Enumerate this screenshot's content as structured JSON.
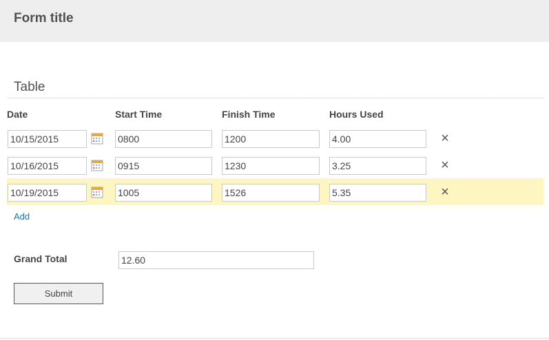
{
  "form": {
    "title": "Form title"
  },
  "section": {
    "title": "Table"
  },
  "table": {
    "columns": [
      "Date",
      "Start Time",
      "Finish Time",
      "Hours Used"
    ],
    "rows": [
      {
        "date": "10/15/2015",
        "start": "0800",
        "finish": "1200",
        "hours": "4.00",
        "highlighted": false
      },
      {
        "date": "10/16/2015",
        "start": "0915",
        "finish": "1230",
        "hours": "3.25",
        "highlighted": false
      },
      {
        "date": "10/19/2015",
        "start": "1005",
        "finish": "1526",
        "hours": "5.35",
        "highlighted": true
      }
    ],
    "add_label": "Add",
    "remove_glyph": "×"
  },
  "totals": {
    "label": "Grand Total",
    "value": "12.60"
  },
  "actions": {
    "submit_label": "Submit"
  },
  "colors": {
    "header_bg": "#eeeeee",
    "highlight_row": "#fdf6c0",
    "link": "#1a73b8",
    "calendar_accent": "#e8a83a"
  },
  "icons": {
    "date_picker": "calendar-icon",
    "remove_row": "close-icon"
  }
}
